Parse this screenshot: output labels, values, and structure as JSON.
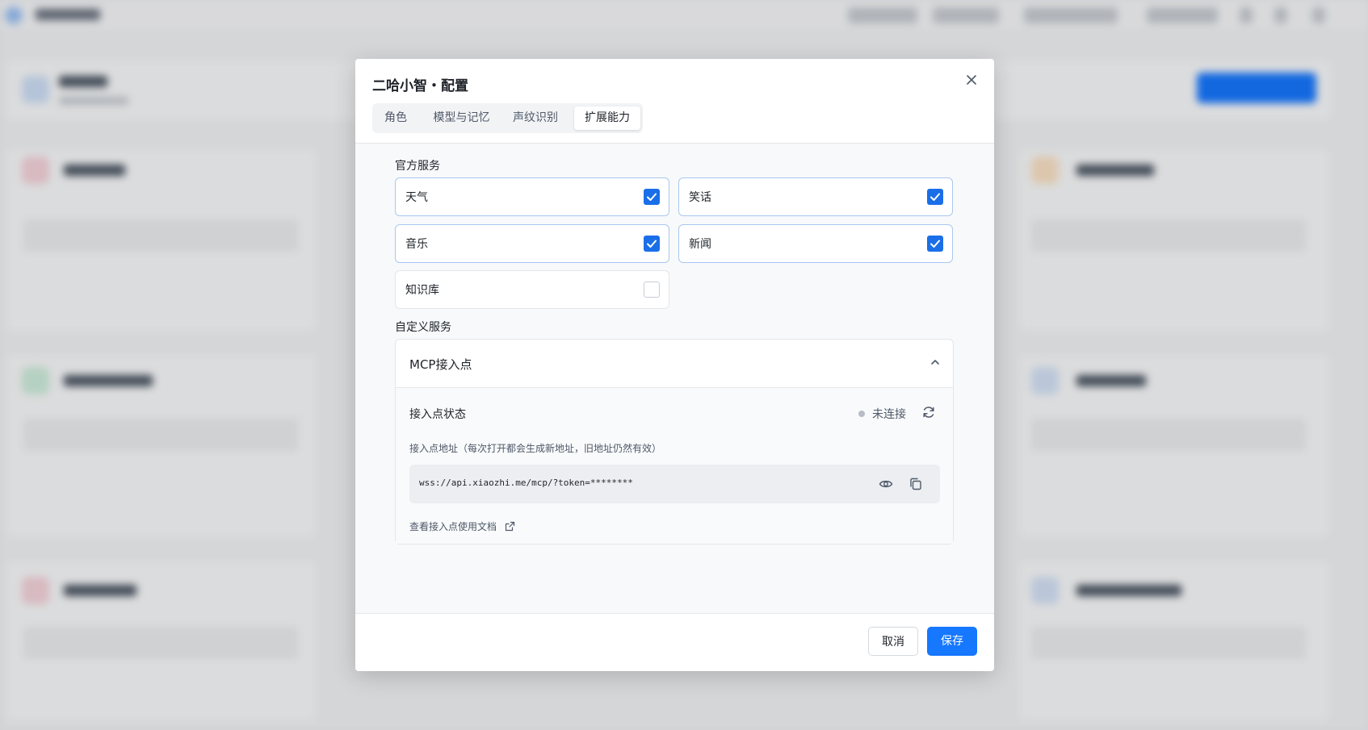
{
  "modal": {
    "title": "二哈小智・配置",
    "tabs": [
      {
        "label": "角色",
        "active": false
      },
      {
        "label": "模型与记忆",
        "active": false
      },
      {
        "label": "声纹识别",
        "active": false
      },
      {
        "label": "扩展能力",
        "active": true
      }
    ],
    "official_services": {
      "label": "官方服务",
      "items": [
        {
          "name": "天气",
          "checked": true
        },
        {
          "name": "笑话",
          "checked": true
        },
        {
          "name": "音乐",
          "checked": true
        },
        {
          "name": "新闻",
          "checked": true
        },
        {
          "name": "知识库",
          "checked": false
        }
      ]
    },
    "custom_services": {
      "label": "自定义服务",
      "mcp": {
        "title": "MCP接入点",
        "status_label": "接入点状态",
        "status_text": "未连接",
        "address_label": "接入点地址（每次打开都会生成新地址，旧地址仍然有效）",
        "address_value": "wss://api.xiaozhi.me/mcp/?token=********",
        "doc_link": "查看接入点使用文档"
      }
    },
    "footer": {
      "cancel_label": "取消",
      "save_label": "保存"
    }
  },
  "colors": {
    "accent": "#1677ff",
    "checkbox_checked": "#1a6fe8",
    "status_disconnected": "#b8bcc4"
  },
  "icons": {
    "close": "close-icon",
    "check": "check-icon",
    "chevron_up": "chevron-up-icon",
    "refresh": "refresh-icon",
    "eye": "eye-icon",
    "copy": "copy-icon",
    "external_link": "external-link-icon"
  }
}
